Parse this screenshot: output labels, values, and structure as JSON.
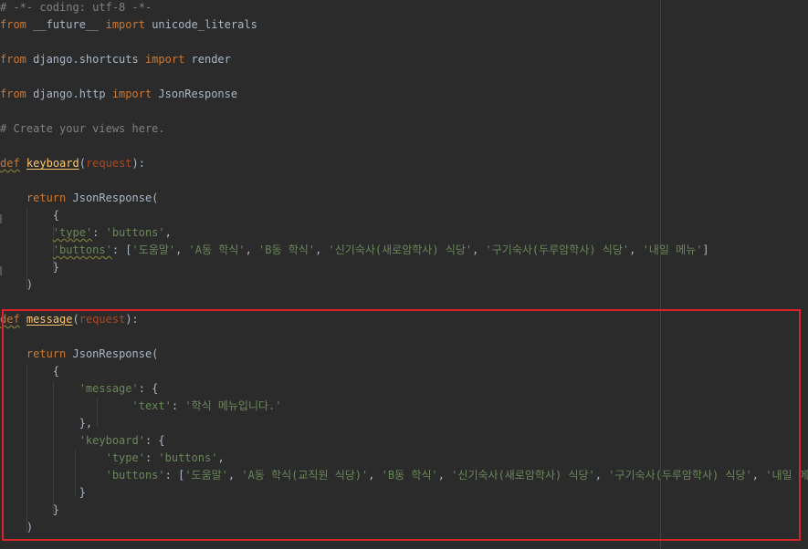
{
  "editor": {
    "lines": [
      {
        "tokens": [
          {
            "t": "# -*- coding: utf-8 -*-",
            "c": "cm"
          }
        ]
      },
      {
        "tokens": [
          {
            "t": "from",
            "c": "kw"
          },
          {
            "t": " __future__ ",
            "c": "pl"
          },
          {
            "t": "import",
            "c": "kw"
          },
          {
            "t": " unicode_literals",
            "c": "pl"
          }
        ]
      },
      {
        "tokens": []
      },
      {
        "tokens": [
          {
            "t": "from",
            "c": "kw"
          },
          {
            "t": " django.shortcuts ",
            "c": "pl"
          },
          {
            "t": "import",
            "c": "kw"
          },
          {
            "t": " render",
            "c": "pl"
          }
        ]
      },
      {
        "tokens": []
      },
      {
        "tokens": [
          {
            "t": "from",
            "c": "kw"
          },
          {
            "t": " django.http ",
            "c": "pl"
          },
          {
            "t": "import",
            "c": "kw"
          },
          {
            "t": " JsonResponse",
            "c": "pl"
          }
        ]
      },
      {
        "tokens": []
      },
      {
        "tokens": [
          {
            "t": "# Create your views here.",
            "c": "cm"
          }
        ]
      },
      {
        "tokens": []
      },
      {
        "tokens": [
          {
            "t": "def",
            "c": "kw sq"
          },
          {
            "t": " ",
            "c": "pl"
          },
          {
            "t": "keyboard",
            "c": "fn ul"
          },
          {
            "t": "(",
            "c": "pl"
          },
          {
            "t": "request",
            "c": "pm"
          },
          {
            "t": "):",
            "c": "pl"
          }
        ]
      },
      {
        "tokens": []
      },
      {
        "tokens": [
          {
            "t": "    ",
            "c": "pl"
          },
          {
            "t": "return",
            "c": "kw"
          },
          {
            "t": " JsonResponse(",
            "c": "pl"
          }
        ]
      },
      {
        "tokens": [
          {
            "t": "        {",
            "c": "pl"
          }
        ]
      },
      {
        "tokens": [
          {
            "t": "        ",
            "c": "pl"
          },
          {
            "t": "'type'",
            "c": "st sq"
          },
          {
            "t": ": ",
            "c": "pl"
          },
          {
            "t": "'buttons'",
            "c": "st"
          },
          {
            "t": ",",
            "c": "pl"
          }
        ]
      },
      {
        "tokens": [
          {
            "t": "        ",
            "c": "pl"
          },
          {
            "t": "'buttons'",
            "c": "st sq"
          },
          {
            "t": ": [",
            "c": "pl"
          },
          {
            "t": "'도움말'",
            "c": "st"
          },
          {
            "t": ", ",
            "c": "pl"
          },
          {
            "t": "'A동 학식'",
            "c": "st"
          },
          {
            "t": ", ",
            "c": "pl"
          },
          {
            "t": "'B동 학식'",
            "c": "st"
          },
          {
            "t": ", ",
            "c": "pl"
          },
          {
            "t": "'신기숙사(새로암학사) 식당'",
            "c": "st"
          },
          {
            "t": ", ",
            "c": "pl"
          },
          {
            "t": "'구기숙사(두루암학사) 식당'",
            "c": "st"
          },
          {
            "t": ", ",
            "c": "pl"
          },
          {
            "t": "'내일 메뉴'",
            "c": "st"
          },
          {
            "t": "]",
            "c": "pl"
          }
        ]
      },
      {
        "tokens": [
          {
            "t": "        }",
            "c": "pl"
          }
        ]
      },
      {
        "tokens": [
          {
            "t": "    )",
            "c": "pl"
          }
        ]
      },
      {
        "tokens": []
      },
      {
        "tokens": [
          {
            "t": "def",
            "c": "kw sq"
          },
          {
            "t": " ",
            "c": "pl"
          },
          {
            "t": "message",
            "c": "fn ul"
          },
          {
            "t": "(",
            "c": "pl"
          },
          {
            "t": "request",
            "c": "pm"
          },
          {
            "t": "):",
            "c": "pl"
          }
        ]
      },
      {
        "tokens": []
      },
      {
        "tokens": [
          {
            "t": "    ",
            "c": "pl"
          },
          {
            "t": "return",
            "c": "kw"
          },
          {
            "t": " JsonResponse(",
            "c": "pl"
          }
        ]
      },
      {
        "tokens": [
          {
            "t": "        {",
            "c": "pl"
          }
        ]
      },
      {
        "tokens": [
          {
            "t": "            ",
            "c": "pl"
          },
          {
            "t": "'message'",
            "c": "st"
          },
          {
            "t": ": {",
            "c": "pl"
          }
        ]
      },
      {
        "tokens": [
          {
            "t": "                    ",
            "c": "pl"
          },
          {
            "t": "'text'",
            "c": "st"
          },
          {
            "t": ": ",
            "c": "pl"
          },
          {
            "t": "'학식 메뉴입니다.'",
            "c": "st"
          }
        ]
      },
      {
        "tokens": [
          {
            "t": "            },",
            "c": "pl"
          }
        ]
      },
      {
        "tokens": [
          {
            "t": "            ",
            "c": "pl"
          },
          {
            "t": "'keyboard'",
            "c": "st"
          },
          {
            "t": ": {",
            "c": "pl"
          }
        ]
      },
      {
        "tokens": [
          {
            "t": "                ",
            "c": "pl"
          },
          {
            "t": "'type'",
            "c": "st"
          },
          {
            "t": ": ",
            "c": "pl"
          },
          {
            "t": "'buttons'",
            "c": "st"
          },
          {
            "t": ",",
            "c": "pl"
          }
        ]
      },
      {
        "tokens": [
          {
            "t": "                ",
            "c": "pl"
          },
          {
            "t": "'buttons'",
            "c": "st"
          },
          {
            "t": ": [",
            "c": "pl"
          },
          {
            "t": "'도움말'",
            "c": "st"
          },
          {
            "t": ", ",
            "c": "pl"
          },
          {
            "t": "'A동 학식(교직원 식당)'",
            "c": "st"
          },
          {
            "t": ", ",
            "c": "pl"
          },
          {
            "t": "'B동 학식'",
            "c": "st"
          },
          {
            "t": ", ",
            "c": "pl"
          },
          {
            "t": "'신기숙사(새로암학사) 식당'",
            "c": "st"
          },
          {
            "t": ", ",
            "c": "pl"
          },
          {
            "t": "'구기숙사(두루암학사) 식당'",
            "c": "st"
          },
          {
            "t": ", ",
            "c": "pl"
          },
          {
            "t": "'내일 메뉴'",
            "c": "st"
          },
          {
            "t": "]",
            "c": "pl"
          }
        ]
      },
      {
        "tokens": [
          {
            "t": "            }",
            "c": "pl"
          }
        ]
      },
      {
        "tokens": [
          {
            "t": "        }",
            "c": "pl"
          }
        ]
      },
      {
        "tokens": [
          {
            "t": "    )",
            "c": "pl"
          }
        ]
      }
    ]
  },
  "colors": {
    "background": "#2b2b2b",
    "keyword": "#cc7832",
    "comment": "#808080",
    "string": "#6a8759",
    "function": "#ffc66d",
    "highlight_border": "#d8232a"
  }
}
